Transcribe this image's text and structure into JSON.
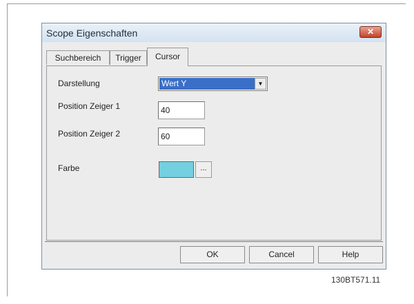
{
  "window": {
    "title": "Scope Eigenschaften",
    "close_icon": "close-icon"
  },
  "tabs": [
    {
      "label": "Suchbereich",
      "active": false
    },
    {
      "label": "Trigger",
      "active": false
    },
    {
      "label": "Cursor",
      "active": true
    }
  ],
  "form": {
    "darstellung": {
      "label": "Darstellung",
      "value": "Wert Y"
    },
    "zeiger1": {
      "label": "Position Zeiger 1",
      "value": "40"
    },
    "zeiger2": {
      "label": "Position Zeiger 2",
      "value": "60"
    },
    "farbe": {
      "label": "Farbe",
      "color": "#74cfde",
      "button_label": "..."
    }
  },
  "buttons": {
    "ok": "OK",
    "cancel": "Cancel",
    "help": "Help"
  },
  "figure_code": "130BT571.11"
}
